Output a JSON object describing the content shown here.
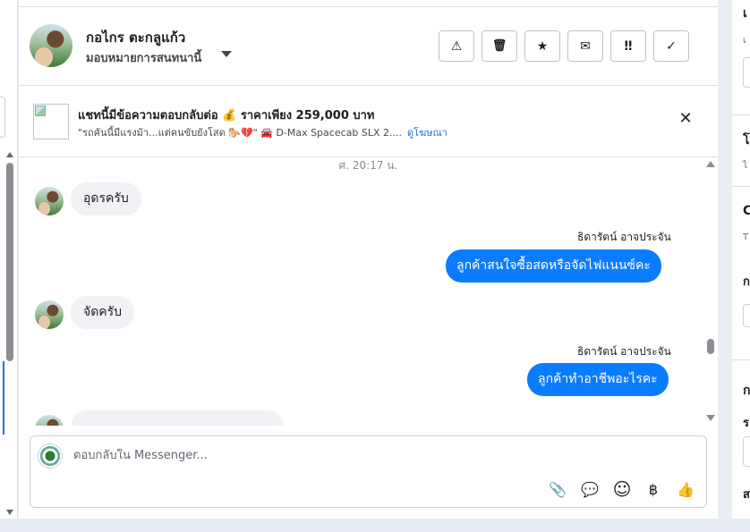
{
  "conversation": {
    "contact_name": "กอไกร ตะกลูแก้ว",
    "assign_label": "มอบหมายการสนทนานี้"
  },
  "toolbar": {
    "spam_icon": "⚠",
    "trash_icon": "🗑",
    "star_icon": "★",
    "mail_icon": "✉",
    "followup_icon": "‼",
    "done_icon": "✓"
  },
  "ad": {
    "title": "แชทนี้มีข้อความตอบกลับต่อ 💰 ราคาเพียง 259,000 บาท",
    "description": "\"รถคันนี้มีแรงม้า...แต่คนขับยังโสด 🐎💔\" 🚘 D-Max Spacecab SLX 2....",
    "link": "ดูโฆษณา",
    "close": "✕"
  },
  "messages": {
    "timestamp": "ศ. 20:17 น.",
    "items": [
      {
        "direction": "in",
        "text": "อุดรครับ"
      },
      {
        "direction": "out",
        "sender": "ธิดารัตน์ อาจประจัน",
        "text": "ลูกค้าสนใจซื้อสดหรือจัดไฟแนนซ์คะ"
      },
      {
        "direction": "in",
        "text": "จัดครับ"
      },
      {
        "direction": "out",
        "sender": "ธิดารัตน์ อาจประจัน",
        "text": "ลูกค้าทำอาชีพอะไรคะ"
      }
    ]
  },
  "composer": {
    "placeholder": "ตอบกลับใน Messenger...",
    "attach_icon": "📎",
    "saved_reply_icon": "💬",
    "emoji_icon": "☺",
    "payment_icon": "฿",
    "like_icon": "👍"
  },
  "right_panel": {
    "letters": [
      "เ",
      "เ",
      "โ",
      "ไ",
      "C",
      "T",
      "ก",
      "ก",
      "ร",
      "ส"
    ]
  },
  "colors": {
    "outgoing_bubble": "#0a7cff",
    "incoming_bubble": "#f0f2f5",
    "link": "#216fdb"
  }
}
